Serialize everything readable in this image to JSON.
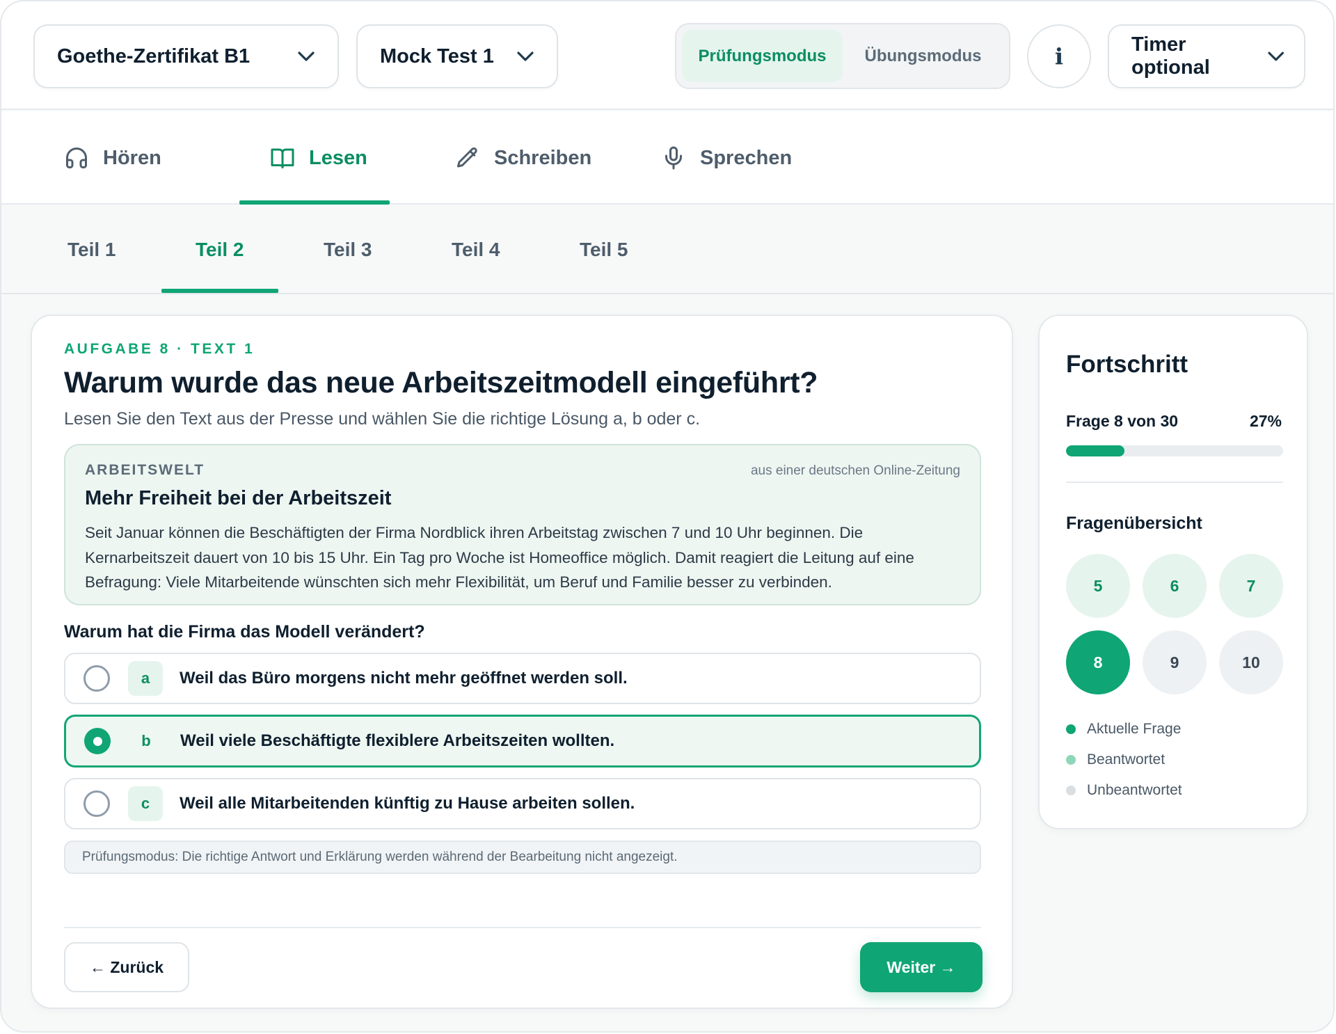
{
  "colors": {
    "accent": "#0fa574",
    "accent_soft": "#e6f4ee",
    "answered_dot": "#8fd6b9",
    "unanswered_dot": "#d9dee3"
  },
  "header": {
    "certificate_select": "Goethe-Zertifikat B1",
    "test_select": "Mock Test 1",
    "mode_exam": "Prüfungsmodus",
    "mode_practice": "Übungsmodus",
    "active_mode": "Prüfungsmodus",
    "info_icon": "i",
    "timer_select": "Timer optional"
  },
  "skills": [
    {
      "label": "Hören",
      "icon": "headphones-icon"
    },
    {
      "label": "Lesen",
      "icon": "book-icon"
    },
    {
      "label": "Schreiben",
      "icon": "pencil-icon"
    },
    {
      "label": "Sprechen",
      "icon": "microphone-icon"
    }
  ],
  "active_skill": "Lesen",
  "teile": [
    "Teil 1",
    "Teil 2",
    "Teil 3",
    "Teil 4",
    "Teil 5"
  ],
  "active_teil": "Teil 2",
  "task": {
    "eyebrow": "AUFGABE 8 · TEXT 1",
    "title": "Warum wurde das neue Arbeitszeitmodell eingeführt?",
    "subtitle": "Lesen Sie den Text aus der Presse und wählen Sie die richtige Lösung a, b oder c.",
    "article": {
      "kicker": "ARBEITSWELT",
      "source": "aus einer deutschen Online-Zeitung",
      "title": "Mehr Freiheit bei der Arbeitszeit",
      "body": "Seit Januar können die Beschäftigten der Firma Nordblick ihren Arbeitstag zwischen 7 und 10 Uhr beginnen. Die Kernarbeitszeit dauert von 10 bis 15 Uhr. Ein Tag pro Woche ist Homeoffice möglich. Damit reagiert die Leitung auf eine Befragung: Viele Mitarbeitende wünschten sich mehr Flexibilität, um Beruf und Familie besser zu verbinden."
    },
    "question": "Warum hat die Firma das Modell verändert?",
    "options": [
      {
        "letter": "a",
        "text": "Weil das Büro morgens nicht mehr geöffnet werden soll.",
        "selected": false
      },
      {
        "letter": "b",
        "text": "Weil viele Beschäftigte flexiblere Arbeitszeiten wollten.",
        "selected": true
      },
      {
        "letter": "c",
        "text": "Weil alle Mitarbeitenden künftig zu Hause arbeiten sollen.",
        "selected": false
      }
    ],
    "hint": "Prüfungsmodus: Die richtige Antwort und Erklärung werden während der Bearbeitung nicht angezeigt.",
    "back_label": "← Zurück",
    "next_label": "Weiter →"
  },
  "progress": {
    "title": "Fortschritt",
    "label": "Frage 8 von 30",
    "percent_label": "27%",
    "fraction": 0.27,
    "overview_title": "Fragenübersicht",
    "questions": [
      {
        "number": "5",
        "state": "answered"
      },
      {
        "number": "6",
        "state": "answered"
      },
      {
        "number": "7",
        "state": "answered"
      },
      {
        "number": "8",
        "state": "current"
      },
      {
        "number": "9",
        "state": "open"
      },
      {
        "number": "10",
        "state": "open"
      }
    ],
    "legend": {
      "current": "Aktuelle Frage",
      "answered": "Beantwortet",
      "open": "Unbeantwortet"
    }
  }
}
